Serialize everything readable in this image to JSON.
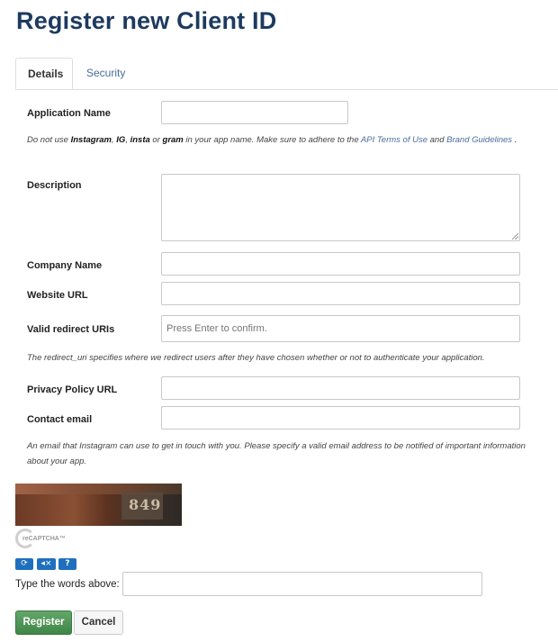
{
  "page": {
    "title": "Register new Client ID"
  },
  "tabs": [
    {
      "label": "Details"
    },
    {
      "label": "Security"
    }
  ],
  "form": {
    "application_name": {
      "label": "Application Name",
      "value": ""
    },
    "app_name_help": {
      "t1": "Do not use ",
      "b1": "Instagram",
      "t2": ", ",
      "b2": "IG",
      "t3": ", ",
      "b3": "insta",
      "t4": " or ",
      "b4": "gram",
      "t5": " in your app name. Make sure to adhere to the ",
      "link1": "API Terms of Use",
      "t6": " and ",
      "link2": "Brand Guidelines",
      "t7": " ."
    },
    "description": {
      "label": "Description",
      "value": ""
    },
    "company_name": {
      "label": "Company Name",
      "value": ""
    },
    "website_url": {
      "label": "Website URL",
      "value": ""
    },
    "redirect_uris": {
      "label": "Valid redirect URIs",
      "placeholder": "Press Enter to confirm."
    },
    "redirect_help": "The redirect_uri specifies where we redirect users after they have chosen whether or not to authenticate your application.",
    "privacy_policy_url": {
      "label": "Privacy Policy URL",
      "value": ""
    },
    "contact_email": {
      "label": "Contact email",
      "value": ""
    },
    "email_help": "An email that Instagram can use to get in touch with you. Please specify a valid email address to be notified of important information about your app."
  },
  "captcha": {
    "image_text": "849",
    "logo_text": "reCAPTCHA™",
    "buttons": {
      "refresh": "⟳",
      "audio": "◂×",
      "help": "?"
    },
    "prompt": "Type the words above:",
    "response_value": ""
  },
  "actions": {
    "register": "Register",
    "cancel": "Cancel"
  },
  "colors": {
    "title": "#1d3a5f",
    "link": "#4a6d9c",
    "primary_button": "#4a9252",
    "captcha_button": "#1f6fbf"
  }
}
